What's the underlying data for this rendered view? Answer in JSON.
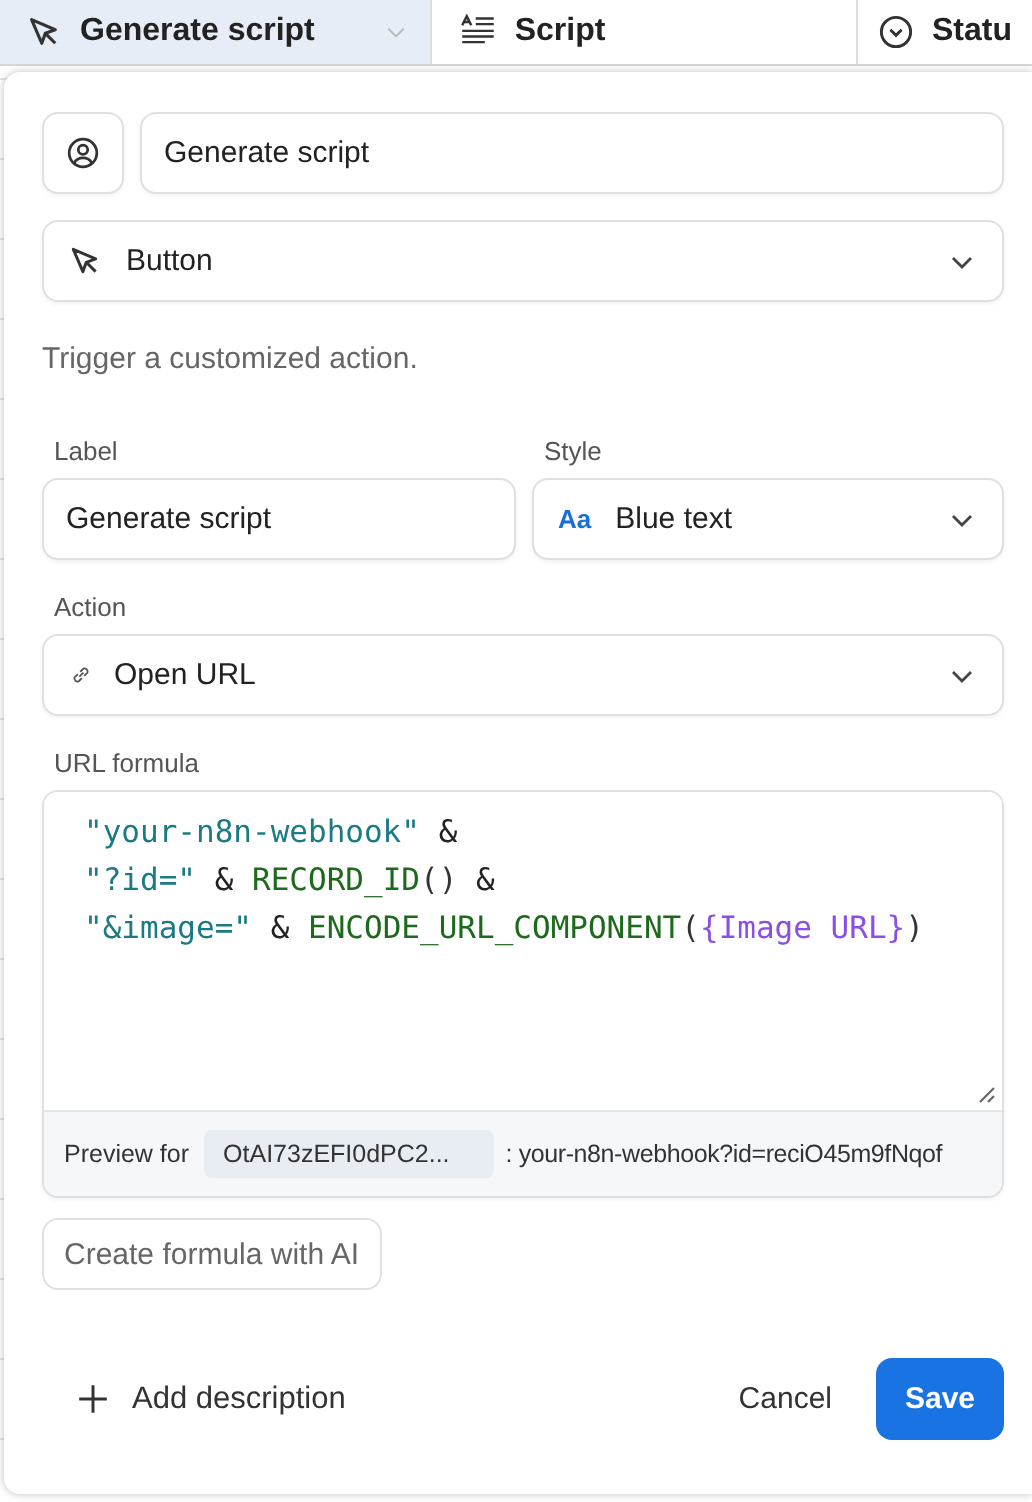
{
  "table": {
    "columns": [
      {
        "label": "Generate script",
        "kind": "button",
        "selected": true
      },
      {
        "label": "Script",
        "kind": "long_text",
        "selected": false
      },
      {
        "label": "Statu",
        "kind": "single_select",
        "selected": false
      }
    ]
  },
  "field_editor": {
    "name": "Generate script",
    "type": "Button",
    "description": "Trigger a customized action.",
    "label": {
      "title": "Label",
      "value": "Generate script"
    },
    "style": {
      "title": "Style",
      "sample": "Aa",
      "value": "Blue text"
    },
    "action": {
      "title": "Action",
      "value": "Open URL"
    },
    "formula": {
      "title": "URL formula",
      "lines": [
        [
          {
            "kind": "string",
            "text": "\"your-n8n-webhook\""
          },
          {
            "kind": "operator",
            "text": " &"
          }
        ],
        [
          {
            "kind": "string",
            "text": "\"?id=\""
          },
          {
            "kind": "operator",
            "text": " & "
          },
          {
            "kind": "function",
            "text": "RECORD_ID"
          },
          {
            "kind": "paren",
            "text": "()"
          },
          {
            "kind": "operator",
            "text": " &"
          }
        ],
        [
          {
            "kind": "string",
            "text": "\"&image=\""
          },
          {
            "kind": "operator",
            "text": " & "
          },
          {
            "kind": "function",
            "text": "ENCODE_URL_COMPONENT"
          },
          {
            "kind": "paren",
            "text": "("
          },
          {
            "kind": "field",
            "text": "{Image URL}"
          },
          {
            "kind": "paren",
            "text": ")"
          }
        ]
      ],
      "preview_label": "Preview for",
      "preview_record": "OtAI73zEFI0dPC2...",
      "preview_value": ": your-n8n-webhook?id=reciO45m9fNqof"
    },
    "ai_button": "Create formula with AI",
    "add_description": "Add description",
    "cancel": "Cancel",
    "save": "Save"
  }
}
